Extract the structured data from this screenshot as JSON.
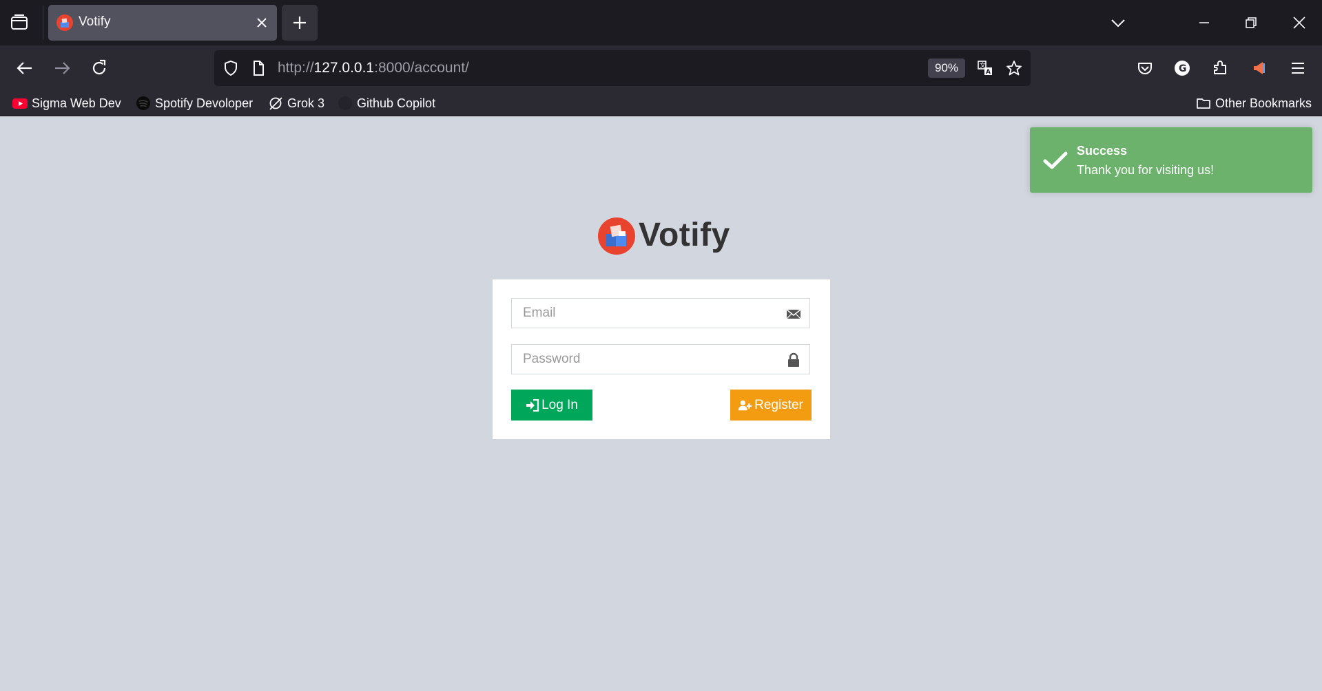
{
  "browser": {
    "tab": {
      "title": "Votify",
      "favicon": "votify-logo-icon"
    },
    "url": {
      "scheme": "http://",
      "host": "127.0.0.1",
      "rest": ":8000/account/"
    },
    "zoom": "90%",
    "bookmarks": [
      {
        "label": "Sigma Web Dev",
        "icon": "youtube-icon"
      },
      {
        "label": "Spotify Devoloper",
        "icon": "spotify-icon"
      },
      {
        "label": "Grok 3",
        "icon": "grok-icon"
      },
      {
        "label": "Github Copilot",
        "icon": "github-icon"
      }
    ],
    "other_bookmarks": "Other Bookmarks",
    "colors": {
      "tabbar": "#1c1b22",
      "toolbar": "#2b2a33"
    }
  },
  "page": {
    "logo_text": "Votify",
    "form": {
      "email_placeholder": "Email",
      "password_placeholder": "Password",
      "login_label": "Log In",
      "register_label": "Register"
    },
    "toast": {
      "title": "Success",
      "message": "Thank you for visiting us!"
    },
    "colors": {
      "background": "#d2d6de",
      "login": "#00a65a",
      "register": "#f39c12",
      "toast": "#6cb16c"
    }
  }
}
